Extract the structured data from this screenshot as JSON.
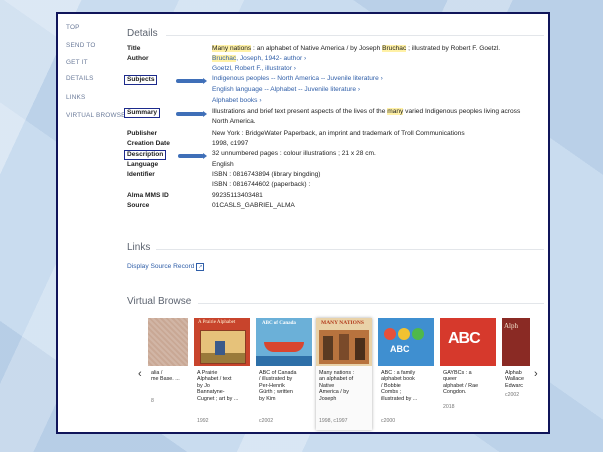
{
  "nav": [
    "TOP",
    "SEND TO",
    "GET IT",
    "DETAILS",
    "LINKS",
    "VIRTUAL BROWSE"
  ],
  "details": {
    "heading": "Details",
    "title_label": "Title",
    "title_pre": "Many nations",
    "title_mid": " : an alphabet of Native America / by Joseph ",
    "title_author": "Bruchac",
    "title_post": " ; illustrated by Robert F. Goetzl.",
    "author_label": "Author",
    "author_1_pre": "Bruchac",
    "author_1_post": ", Joseph, 1942- author",
    "author_2": "Goetzl, Robert F., illustrator",
    "subjects_label": "Subjects",
    "subject_1": "Indigenous peoples -- North America -- Juvenile literature",
    "subject_2": "English language -- Alphabet -- Juvenile literature",
    "subject_3": "Alphabet books",
    "summary_label": "Summary",
    "summary_1a": "Illustrations and brief text present aspects of the lives of the ",
    "summary_1b": "many",
    "summary_1c": " varied Indigenous peoples living across",
    "summary_2": "North America.",
    "publisher_label": "Publisher",
    "publisher": "New York : BridgeWater Paperback, an imprint and trademark of Troll Communications",
    "creation_label": "Creation Date",
    "creation": "1998, c1997",
    "description_label": "Description",
    "description": "32 unnumbered pages : colour illustrations ; 21 x 28 cm.",
    "language_label": "Language",
    "language": "English",
    "identifier_label": "Identifier",
    "identifier_1": "ISBN : 0816743894 (library bingding)",
    "identifier_2": "ISBN : 0816744602 (paperback) :",
    "mms_label": "Alma MMS ID",
    "mms": "99235113403481",
    "source_label": "Source",
    "source": "01CASLS_GABRIEL_ALMA",
    "arrow_glyph": "›"
  },
  "links": {
    "heading": "Links",
    "display_source": "Display Source Record",
    "ext_icon": "↗"
  },
  "virtual_browse": {
    "heading": "Virtual Browse",
    "prev": "‹",
    "next": "›",
    "items": [
      {
        "text": "alia /\nme Base. ...",
        "date": "8",
        "cover_text": ""
      },
      {
        "text": "A Prairie\nAlphabet / text\nby Jo\nBannatyne-\nCugnet ; art by ...",
        "date": "1992",
        "cover_text": "A Prairie Alphabet"
      },
      {
        "text": "ABC of Canada\n/ illustrated by\nPer-Henrik\nGürth ; written\nby Kim",
        "date": "c2002",
        "cover_text": "ABC of Canada"
      },
      {
        "text": "Many nations :\nan alphabet of\nNative\nAmerica / by\nJoseph",
        "date": "1998, c1997",
        "cover_text": "MANY NATIONS"
      },
      {
        "text": "ABC : a family\nalphabet book\n/ Bobbie\nCombs ;\nillustrated by ...",
        "date": "c2000",
        "cover_text": "ABC"
      },
      {
        "text": "GAYBCs : a\nqueer\nalphabet / Rae\nCongdon.",
        "date": "2018",
        "cover_text": "ABC"
      },
      {
        "text": "Alphab\nWallace\nEdwarc",
        "date": "c2002",
        "cover_text": "Alph"
      }
    ]
  }
}
